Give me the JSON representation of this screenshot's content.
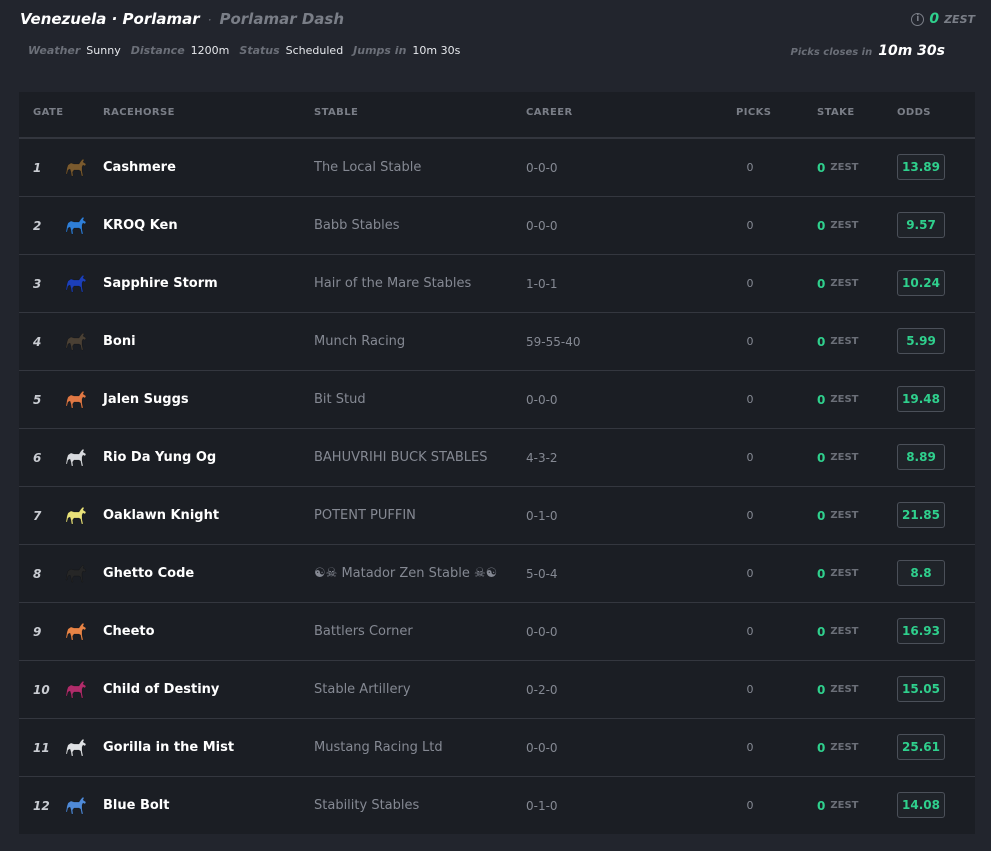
{
  "header": {
    "location": "Venezuela · Porlamar",
    "separator": "·",
    "race_name": "Porlamar Dash",
    "balance": {
      "value": "0",
      "currency": "ZEST"
    },
    "meta": {
      "weather_label": "Weather",
      "weather_value": "Sunny",
      "distance_label": "Distance",
      "distance_value": "1200m",
      "status_label": "Status",
      "status_value": "Scheduled",
      "jumps_label": "Jumps in",
      "jumps_value": "10m 30s"
    },
    "picks_closes_label": "Picks closes in",
    "picks_closes_value": "10m 30s"
  },
  "table": {
    "columns": {
      "gate": "GATE",
      "racehorse": "RACEHORSE",
      "stable": "STABLE",
      "career": "CAREER",
      "picks": "PICKS",
      "stake": "STAKE",
      "odds": "ODDS"
    },
    "stake_currency": "ZEST",
    "rows": [
      {
        "gate": "1",
        "name": "Cashmere",
        "stable": "The Local Stable",
        "career": "0-0-0",
        "picks": "0",
        "stake": "0",
        "odds": "13.89",
        "color": "#7a5a2e"
      },
      {
        "gate": "2",
        "name": "KROQ Ken",
        "stable": "Babb Stables",
        "career": "0-0-0",
        "picks": "0",
        "stake": "0",
        "odds": "9.57",
        "color": "#2f7fd8"
      },
      {
        "gate": "3",
        "name": "Sapphire Storm",
        "stable": "Hair of the Mare Stables",
        "career": "1-0-1",
        "picks": "0",
        "stake": "0",
        "odds": "10.24",
        "color": "#1c3fb8"
      },
      {
        "gate": "4",
        "name": "Boni",
        "stable": "Munch Racing",
        "career": "59-55-40",
        "picks": "0",
        "stake": "0",
        "odds": "5.99",
        "color": "#4a4034"
      },
      {
        "gate": "5",
        "name": "Jalen Suggs",
        "stable": "Bit Stud",
        "career": "0-0-0",
        "picks": "0",
        "stake": "0",
        "odds": "19.48",
        "color": "#e07844"
      },
      {
        "gate": "6",
        "name": "Rio Da Yung Og",
        "stable": "BAHUVRIHI BUCK STABLES",
        "career": "4-3-2",
        "picks": "0",
        "stake": "0",
        "odds": "8.89",
        "color": "#d8dade"
      },
      {
        "gate": "7",
        "name": "Oaklawn Knight",
        "stable": "POTENT PUFFIN",
        "career": "0-1-0",
        "picks": "0",
        "stake": "0",
        "odds": "21.85",
        "color": "#e9e27a"
      },
      {
        "gate": "8",
        "name": "Ghetto Code",
        "stable": "☯☠ Matador Zen Stable ☠☯",
        "career": "5-0-4",
        "picks": "0",
        "stake": "0",
        "odds": "8.8",
        "color": "#262626"
      },
      {
        "gate": "9",
        "name": "Cheeto",
        "stable": "Battlers Corner",
        "career": "0-0-0",
        "picks": "0",
        "stake": "0",
        "odds": "16.93",
        "color": "#e88446"
      },
      {
        "gate": "10",
        "name": "Child of Destiny",
        "stable": "Stable Artillery",
        "career": "0-2-0",
        "picks": "0",
        "stake": "0",
        "odds": "15.05",
        "color": "#b02c6a"
      },
      {
        "gate": "11",
        "name": "Gorilla in the Mist",
        "stable": "Mustang Racing Ltd",
        "career": "0-0-0",
        "picks": "0",
        "stake": "0",
        "odds": "25.61",
        "color": "#dfe1e4"
      },
      {
        "gate": "12",
        "name": "Blue Bolt",
        "stable": "Stability Stables",
        "career": "0-1-0",
        "picks": "0",
        "stake": "0",
        "odds": "14.08",
        "color": "#4f8ad8"
      }
    ]
  }
}
